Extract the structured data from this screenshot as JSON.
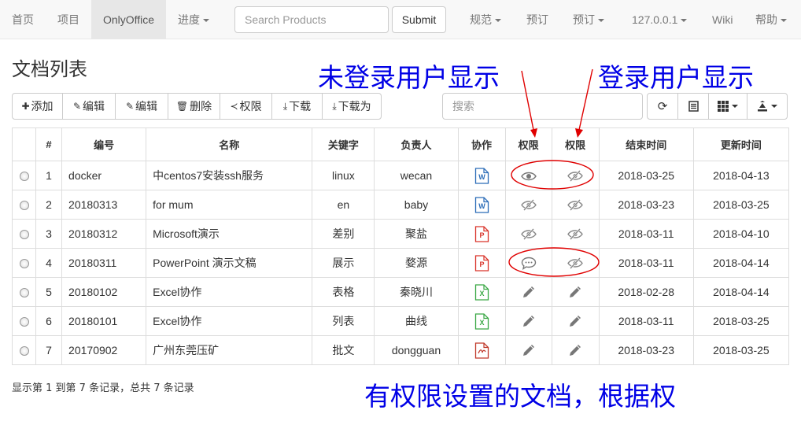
{
  "navbar": {
    "items": [
      {
        "label": "首页",
        "dropdown": false,
        "active": false
      },
      {
        "label": "项目",
        "dropdown": false,
        "active": false
      },
      {
        "label": "OnlyOffice",
        "dropdown": false,
        "active": true
      },
      {
        "label": "进度",
        "dropdown": true,
        "active": false
      }
    ],
    "search_placeholder": "Search Products",
    "submit_label": "Submit",
    "right_items": [
      {
        "label": "规范",
        "dropdown": true
      },
      {
        "label": "预订",
        "dropdown": false
      },
      {
        "label": "预订",
        "dropdown": true
      },
      {
        "label": "127.0.0.1",
        "dropdown": true
      },
      {
        "label": "Wiki",
        "dropdown": false
      },
      {
        "label": "帮助",
        "dropdown": true
      }
    ]
  },
  "page_title": "文档列表",
  "annotations": {
    "not_logged_in": "未登录用户显示",
    "logged_in": "登录用户显示",
    "bottom_note": "有权限设置的文档，根据权"
  },
  "toolbar": {
    "buttons": [
      {
        "label": "添加",
        "icon": "plus-icon"
      },
      {
        "label": "编辑",
        "icon": "edit-icon"
      },
      {
        "label": "编辑",
        "icon": "edit-icon"
      },
      {
        "label": "删除",
        "icon": "trash-icon"
      },
      {
        "label": "权限",
        "icon": "share-icon"
      },
      {
        "label": "下载",
        "icon": "download-icon"
      },
      {
        "label": "下载为",
        "icon": "download-icon"
      }
    ],
    "search_placeholder": "搜索",
    "right_buttons": [
      "refresh-icon",
      "list-icon",
      "columns-icon",
      "export-icon"
    ]
  },
  "table": {
    "headers": [
      "",
      "#",
      "编号",
      "名称",
      "关键字",
      "负责人",
      "协作",
      "权限",
      "权限",
      "结束时间",
      "更新时间"
    ],
    "rows": [
      {
        "num": "1",
        "code": "docker",
        "name": "中centos7安装ssh服务",
        "keyword": "linux",
        "owner": "wecan",
        "type": "word",
        "perm1": "eye",
        "perm2": "eye-slash",
        "end": "2018-03-25",
        "updated": "2018-04-13"
      },
      {
        "num": "2",
        "code": "20180313",
        "name": "for mum",
        "keyword": "en",
        "owner": "baby",
        "type": "word",
        "perm1": "eye-slash",
        "perm2": "eye-slash",
        "end": "2018-03-23",
        "updated": "2018-03-25"
      },
      {
        "num": "3",
        "code": "20180312",
        "name": "Microsoft演示",
        "keyword": "差别",
        "owner": "聚盐",
        "type": "ppt",
        "perm1": "eye-slash",
        "perm2": "eye-slash",
        "end": "2018-03-11",
        "updated": "2018-04-10"
      },
      {
        "num": "4",
        "code": "20180311",
        "name": "PowerPoint 演示文稿",
        "keyword": "展示",
        "owner": "婺源",
        "type": "ppt",
        "perm1": "comment",
        "perm2": "eye-slash",
        "end": "2018-03-11",
        "updated": "2018-04-14"
      },
      {
        "num": "5",
        "code": "20180102",
        "name": "Excel协作",
        "keyword": "表格",
        "owner": "秦晓川",
        "type": "excel",
        "perm1": "pencil",
        "perm2": "pencil",
        "end": "2018-02-28",
        "updated": "2018-04-14"
      },
      {
        "num": "6",
        "code": "20180101",
        "name": "Excel协作",
        "keyword": "列表",
        "owner": "曲线",
        "type": "excel",
        "perm1": "pencil",
        "perm2": "pencil",
        "end": "2018-03-11",
        "updated": "2018-03-25"
      },
      {
        "num": "7",
        "code": "20170902",
        "name": "广州东莞压矿",
        "keyword": "批文",
        "owner": "dongguan",
        "type": "pdf",
        "perm1": "pencil",
        "perm2": "pencil",
        "end": "2018-03-23",
        "updated": "2018-03-25"
      }
    ]
  },
  "footer": "显示第 1 到第 7 条记录，总共 7 条记录",
  "colors": {
    "link": "#337ab7",
    "annotation": "#0000e6",
    "annotation_shapes": "#e00000",
    "word": "#2b6cb8",
    "ppt": "#d9342b",
    "excel": "#3aa845",
    "pdf": "#c0392b"
  }
}
